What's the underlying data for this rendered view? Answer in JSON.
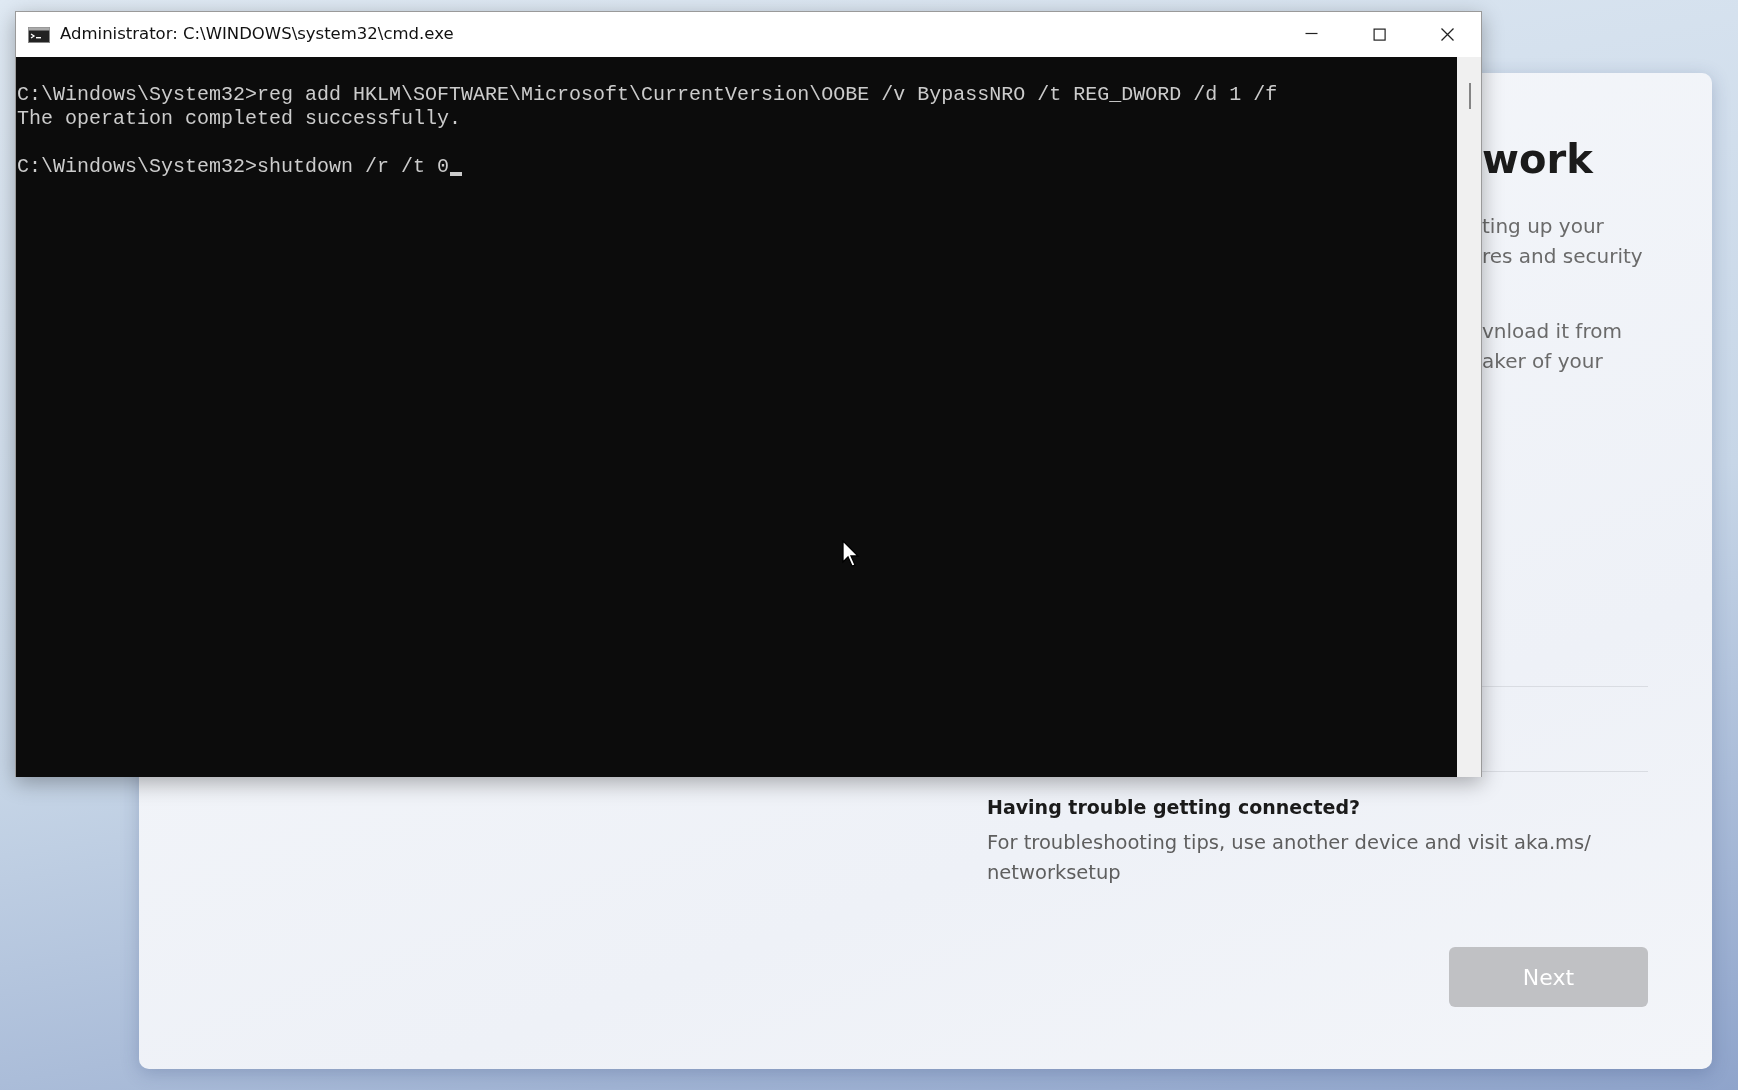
{
  "cmd_window": {
    "title": "Administrator: C:\\WINDOWS\\system32\\cmd.exe",
    "output_blocks": [
      [
        "C:\\Windows\\System32>reg add HKLM\\SOFTWARE\\Microsoft\\CurrentVersion\\OOBE /v BypassNRO /t REG_DWORD /d 1 /f",
        "The operation completed successfully."
      ],
      [
        "C:\\Windows\\System32>shutdown /r /t 0"
      ]
    ]
  },
  "setup_card": {
    "heading_fragment": "work",
    "paragraph_fragments": [
      [
        "ting up your",
        "res and security"
      ],
      [
        "vnload it from",
        "aker of your"
      ]
    ],
    "help": {
      "title": "Having trouble getting connected?",
      "text_lines": [
        "For troubleshooting tips, use another device and visit aka.ms/",
        "networksetup"
      ]
    },
    "next_button": {
      "label": "Next",
      "disabled": true
    }
  }
}
